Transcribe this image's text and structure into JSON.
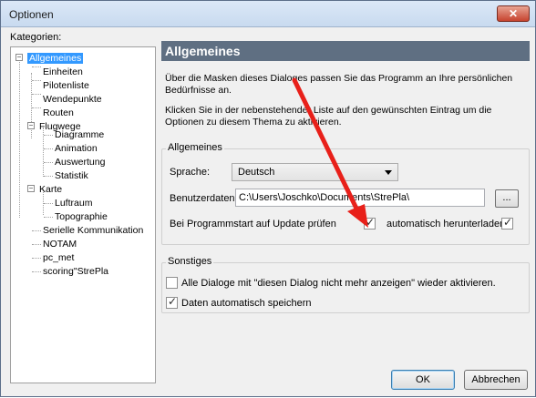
{
  "window": {
    "title": "Optionen",
    "close_label": "✕"
  },
  "categories": {
    "label": "Kategorien:",
    "items": [
      {
        "label": "Allgemeines",
        "selected": true
      },
      {
        "label": "Einheiten"
      },
      {
        "label": "Pilotenliste"
      },
      {
        "label": "Wendepunkte"
      },
      {
        "label": "Routen"
      },
      {
        "label": "Flugwege"
      },
      {
        "label": "Diagramme"
      },
      {
        "label": "Animation"
      },
      {
        "label": "Auswertung"
      },
      {
        "label": "Statistik"
      },
      {
        "label": "Karte"
      },
      {
        "label": "Luftraum"
      },
      {
        "label": "Topographie"
      },
      {
        "label": "Serielle Kommunikation"
      },
      {
        "label": "NOTAM"
      },
      {
        "label": "pc_met"
      },
      {
        "label": "scoring\"StrePla"
      }
    ]
  },
  "panel": {
    "header": "Allgemeines",
    "desc1": "Über die Masken dieses Dialoges passen Sie das Programm an Ihre persönlichen Bedürfnisse an.",
    "desc2": "Klicken Sie in der nebenstehender Liste auf den gewünschten Eintrag um die Optionen zu diesem Thema zu aktivieren."
  },
  "general_group": {
    "title": "Allgemeines",
    "language_label": "Sprache:",
    "language_value": "Deutsch",
    "userdata_label": "Benutzerdaten:",
    "userdata_value": "C:\\Users\\Joschko\\Documents\\StrePla\\",
    "browse_label": "...",
    "update_label": "Bei Programmstart auf Update prüfen",
    "update_checked": true,
    "autodownload_label": "automatisch herunterladen",
    "autodownload_checked": true
  },
  "other_group": {
    "title": "Sonstiges",
    "reactivate_label": "Alle Dialoge mit \"diesen Dialog nicht mehr anzeigen\" wieder aktivieren.",
    "reactivate_checked": false,
    "autosave_label": "Daten automatisch speichern",
    "autosave_checked": true
  },
  "footer": {
    "ok_label": "OK",
    "cancel_label": "Abbrechen"
  },
  "colors": {
    "panel_header": "#5f6f82",
    "selection": "#3399ff",
    "annotation_arrow": "#e8201a"
  }
}
